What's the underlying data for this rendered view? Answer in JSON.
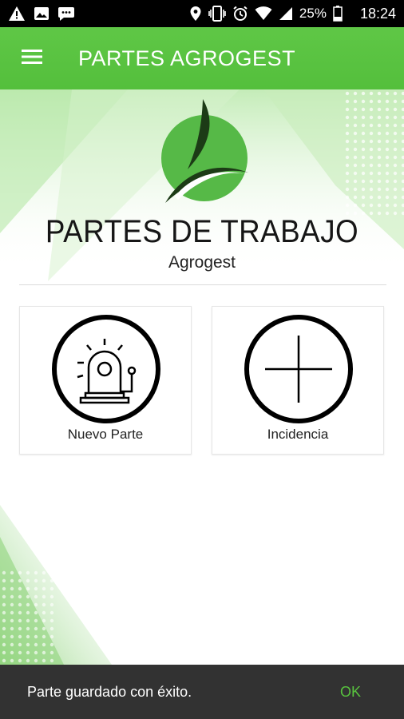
{
  "status_bar": {
    "battery": "25%",
    "time": "18:24",
    "icons": [
      "warning-icon",
      "image-icon",
      "message-icon",
      "location-icon",
      "vibrate-icon",
      "alarm-icon",
      "wifi-icon",
      "signal-icon",
      "battery-icon"
    ]
  },
  "app_bar": {
    "title": "PARTES AGROGEST",
    "menu_icon": "hamburger-icon",
    "color": "#5fc746"
  },
  "header": {
    "title": "PARTES DE TRABAJO",
    "subtitle": "Agrogest"
  },
  "actions": [
    {
      "label": "Nuevo Parte",
      "icon": "alarm-bell-icon"
    },
    {
      "label": "Incidencia",
      "icon": "plus-icon"
    }
  ],
  "snackbar": {
    "message": "Parte guardado con éxito.",
    "action": "OK",
    "action_color": "#58c33e"
  }
}
